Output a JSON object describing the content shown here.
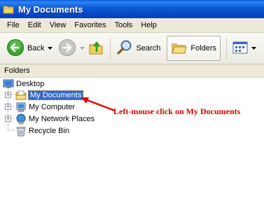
{
  "window": {
    "title": "My Documents"
  },
  "menubar": {
    "items": [
      "File",
      "Edit",
      "View",
      "Favorites",
      "Tools",
      "Help"
    ]
  },
  "toolbar": {
    "back_label": "Back",
    "search_label": "Search",
    "folders_label": "Folders"
  },
  "folders_pane": {
    "header": "Folders",
    "tree": [
      {
        "label": "Desktop",
        "icon": "desktop-icon"
      },
      {
        "label": "My Documents",
        "icon": "my-documents-icon",
        "selected": true,
        "expander": "+"
      },
      {
        "label": "My Computer",
        "icon": "my-computer-icon",
        "expander": "+"
      },
      {
        "label": "My Network Places",
        "icon": "network-places-icon",
        "expander": "+"
      },
      {
        "label": "Recycle Bin",
        "icon": "recycle-bin-icon"
      }
    ]
  },
  "annotation": {
    "text": "Left-mouse click on My Documents",
    "color": "#e00000"
  }
}
